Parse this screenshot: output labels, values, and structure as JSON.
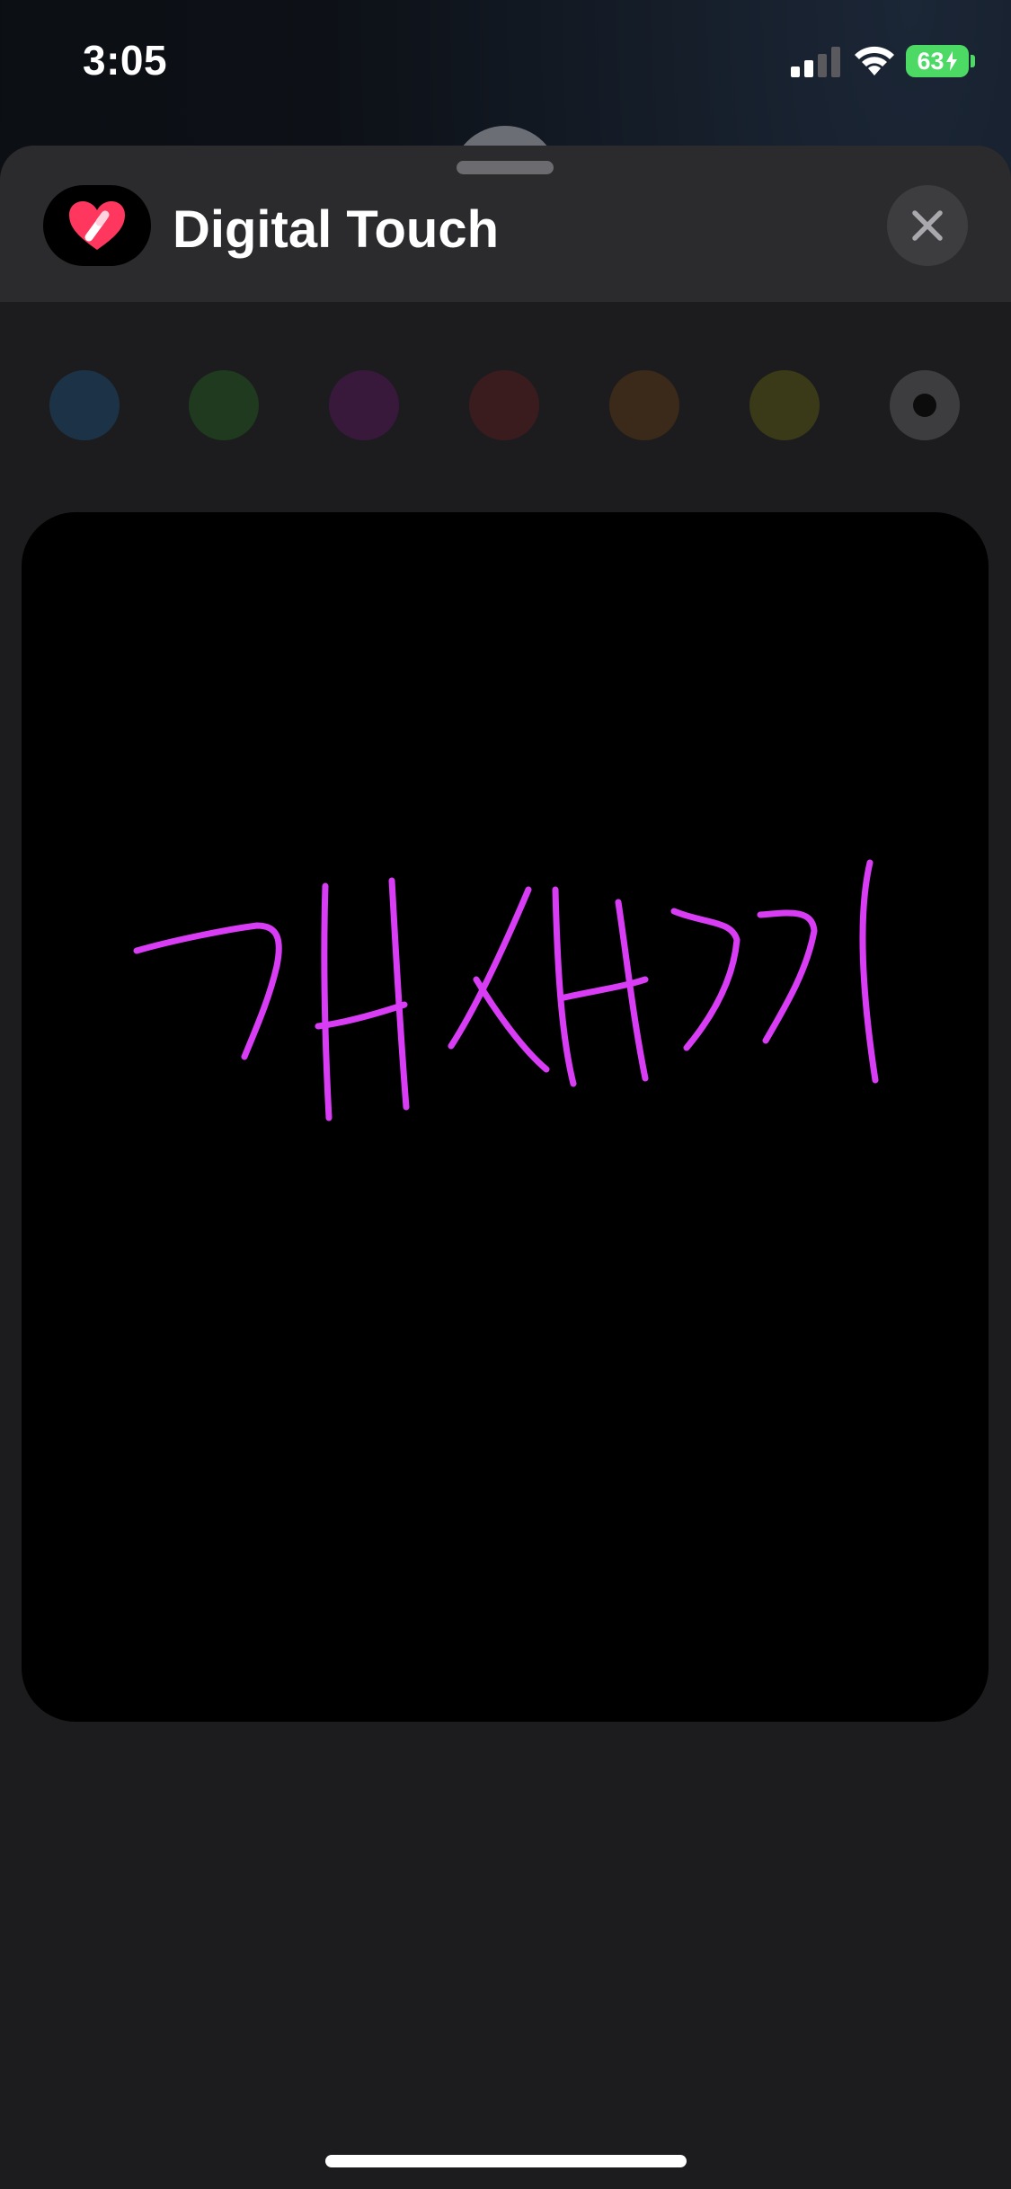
{
  "status_bar": {
    "time": "3:05",
    "battery_percent": "63",
    "battery_color": "#4cd964",
    "icons": [
      "cellular-signal-icon",
      "wifi-icon",
      "battery-charging-icon"
    ]
  },
  "sheet": {
    "title": "Digital Touch",
    "app_icon": "digital-touch-heart-icon",
    "close_icon": "close-icon"
  },
  "palette": {
    "colors": [
      "#1c3347",
      "#1f3a1f",
      "#38193c",
      "#3a1c1e",
      "#3b2a1a",
      "#3a3a19"
    ],
    "custom_color": "color-picker",
    "selected_stroke_color": "#d93cf5"
  },
  "canvas": {
    "background": "#000000",
    "drawing": "handwritten strokes"
  }
}
